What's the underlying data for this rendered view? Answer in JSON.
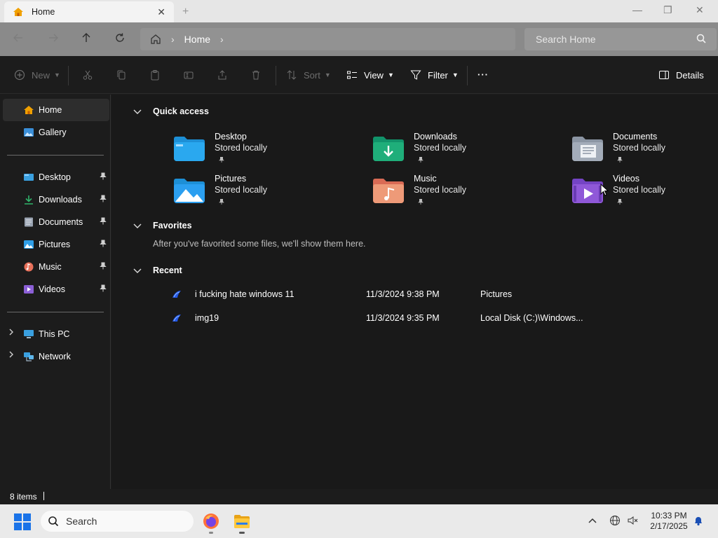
{
  "window": {
    "tab_title": "Home",
    "tab_close": "✕",
    "new_tab": "+",
    "minimize": "—",
    "maximize": "❐",
    "close": "✕"
  },
  "address": {
    "breadcrumb": [
      "Home"
    ],
    "search_placeholder": "Search Home"
  },
  "toolbar": {
    "new_label": "New",
    "sort_label": "Sort",
    "view_label": "View",
    "filter_label": "Filter",
    "more_label": "···",
    "details_label": "Details"
  },
  "sidebar": {
    "top_items": [
      {
        "label": "Home",
        "icon": "home-icon",
        "selected": true
      },
      {
        "label": "Gallery",
        "icon": "gallery-icon"
      }
    ],
    "pinned_items": [
      {
        "label": "Desktop",
        "icon": "desktop-icon",
        "color": "#3aa0e0"
      },
      {
        "label": "Downloads",
        "icon": "downloads-icon",
        "color": "#2fb36a"
      },
      {
        "label": "Documents",
        "icon": "documents-icon",
        "color": "#9aa4b2"
      },
      {
        "label": "Pictures",
        "icon": "pictures-icon",
        "color": "#2f9fe8"
      },
      {
        "label": "Music",
        "icon": "music-icon",
        "color": "#e8705a"
      },
      {
        "label": "Videos",
        "icon": "videos-icon",
        "color": "#8b5fd6"
      }
    ],
    "pin_glyph": "📌",
    "bottom_items": [
      {
        "label": "This PC",
        "icon": "this-pc-icon"
      },
      {
        "label": "Network",
        "icon": "network-icon"
      }
    ]
  },
  "quick_access": {
    "title": "Quick access",
    "items": [
      {
        "name": "Desktop",
        "status": "Stored locally",
        "color": "#2a9fe6"
      },
      {
        "name": "Downloads",
        "status": "Stored locally",
        "color": "#1fae7a"
      },
      {
        "name": "Documents",
        "status": "Stored locally",
        "color": "#a3acb9"
      },
      {
        "name": "Pictures",
        "status": "Stored locally",
        "color": "#2b9ff0"
      },
      {
        "name": "Music",
        "status": "Stored locally",
        "color": "#e98866"
      },
      {
        "name": "Videos",
        "status": "Stored locally",
        "color": "#8f58d8"
      }
    ]
  },
  "favorites": {
    "title": "Favorites",
    "empty_message": "After you've favorited some files, we'll show them here."
  },
  "recent": {
    "title": "Recent",
    "rows": [
      {
        "name": "i fucking hate windows 11",
        "date": "11/3/2024 9:38 PM",
        "location": "Pictures"
      },
      {
        "name": "img19",
        "date": "11/3/2024 9:35 PM",
        "location": "Local Disk (C:)\\Windows..."
      }
    ]
  },
  "status": {
    "item_count": "8 items"
  },
  "taskbar": {
    "search_placeholder": "Search",
    "time": "10:33 PM",
    "date": "2/17/2025"
  }
}
